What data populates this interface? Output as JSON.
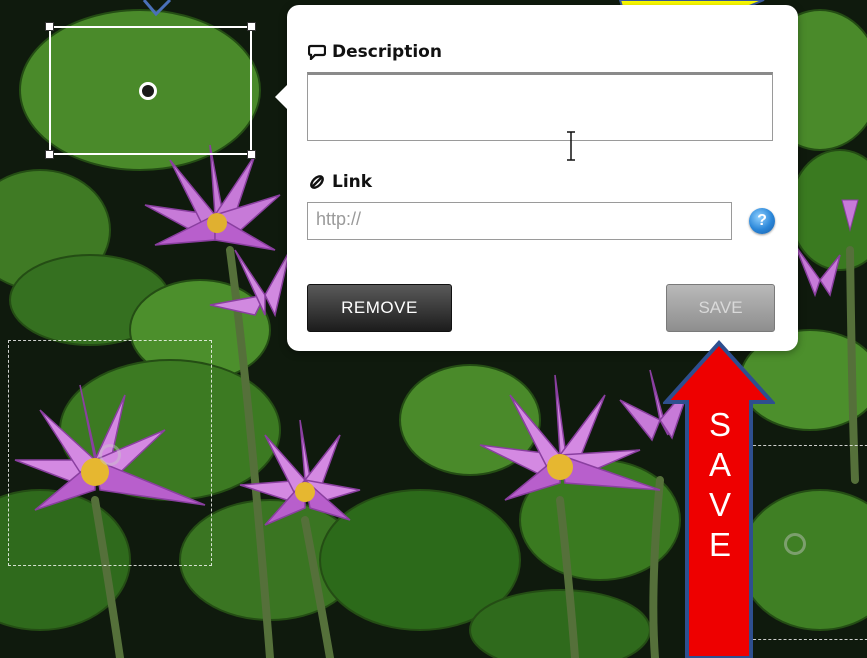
{
  "popup": {
    "description_label": "Description",
    "description_value": "",
    "link_label": "Link",
    "link_placeholder": "http://",
    "help_icon": "?",
    "remove_label": "REMOVE",
    "save_label": "SAVE"
  },
  "annotation": {
    "save_letters": [
      "S",
      "A",
      "V",
      "E"
    ],
    "arrow_color": "#ee0000",
    "arrow_border": "#2e4f8f",
    "callout_color": "#ffff00"
  },
  "icons": {
    "description": "speech-bubble-icon",
    "link": "chain-link-icon",
    "help": "help-question-icon",
    "text_cursor": "text-cursor-icon"
  }
}
